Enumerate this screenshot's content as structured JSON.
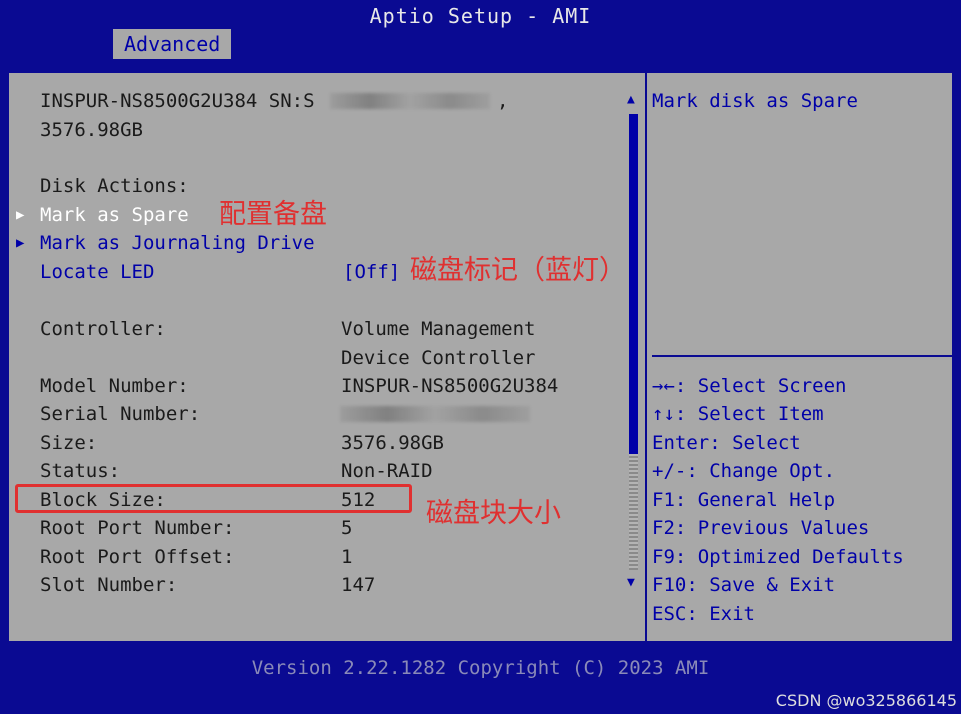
{
  "header": {
    "title": "Aptio Setup - AMI",
    "tab": "Advanced"
  },
  "disk": {
    "line1": "INSPUR-NS8500G2U384 SN:S",
    "line1_end": ",",
    "line2": "3576.98GB"
  },
  "actions": {
    "heading": "Disk Actions:",
    "mark_spare": "Mark as Spare",
    "mark_journaling": "Mark as Journaling Drive",
    "locate_led": "Locate LED",
    "locate_led_value": "[Off]"
  },
  "info": {
    "rows": [
      {
        "label": "Controller:",
        "value": "Volume Management"
      },
      {
        "label": "",
        "value": "Device Controller"
      },
      {
        "label": "Model Number:",
        "value": "INSPUR-NS8500G2U384"
      },
      {
        "label": "Serial Number:",
        "value": ""
      },
      {
        "label": "Size:",
        "value": "3576.98GB"
      },
      {
        "label": "Status:",
        "value": "Non-RAID"
      },
      {
        "label": "Block Size:",
        "value": "512"
      },
      {
        "label": "Root Port Number:",
        "value": "5"
      },
      {
        "label": "Root Port Offset:",
        "value": "1"
      },
      {
        "label": "Slot Number:",
        "value": "147"
      }
    ]
  },
  "help": {
    "description": "Mark disk as Spare",
    "keys": [
      "→←: Select Screen",
      "↑↓: Select Item",
      "Enter: Select",
      "+/-: Change Opt.",
      "F1: General Help",
      "F2: Previous Values",
      "F9: Optimized Defaults",
      "F10: Save & Exit",
      "ESC: Exit"
    ]
  },
  "annotations": {
    "spare": "配置备盘",
    "led": "磁盘标记（蓝灯）",
    "block": "磁盘块大小"
  },
  "footer": "Version 2.22.1282 Copyright (C) 2023 AMI",
  "watermark": "CSDN @wo325866145",
  "icons": {
    "menu_arrow": "triangle-right-icon",
    "scroll_up": "triangle-up-icon",
    "scroll_down": "triangle-down-icon"
  },
  "colors": {
    "background": "#0a0a92",
    "panel": "#a8a8a8",
    "highlight": "#0000a8",
    "annotation": "#e03030"
  }
}
